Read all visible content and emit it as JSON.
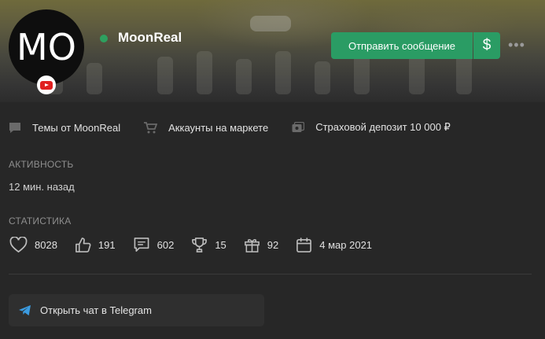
{
  "profile": {
    "avatar_initials": "MO",
    "username": "MoonReal",
    "online": true,
    "social_badge_icon": "youtube-icon"
  },
  "actions": {
    "send_message_label": "Отправить сообщение",
    "donate_label": "$",
    "more_label": "•••"
  },
  "links": [
    {
      "icon": "chat-icon",
      "label": "Темы от MoonReal"
    },
    {
      "icon": "cart-icon",
      "label": "Аккаунты на маркете"
    },
    {
      "icon": "deposit-icon",
      "label": "Страховой депозит 10 000 ₽"
    }
  ],
  "activity": {
    "title": "Активность",
    "value": "12 мин. назад"
  },
  "statistics": {
    "title": "Статистика",
    "items": [
      {
        "icon": "heart-icon",
        "value": "8028"
      },
      {
        "icon": "thumbs-up-icon",
        "value": "191"
      },
      {
        "icon": "message-icon",
        "value": "602"
      },
      {
        "icon": "trophy-icon",
        "value": "15"
      },
      {
        "icon": "gift-icon",
        "value": "92"
      },
      {
        "icon": "calendar-icon",
        "value": "4 мар 2021"
      }
    ]
  },
  "telegram": {
    "label": "Открыть чат в Telegram",
    "icon": "telegram-icon"
  },
  "colors": {
    "accent": "#2a9c64",
    "background": "#272727",
    "online": "#2ea05f"
  }
}
